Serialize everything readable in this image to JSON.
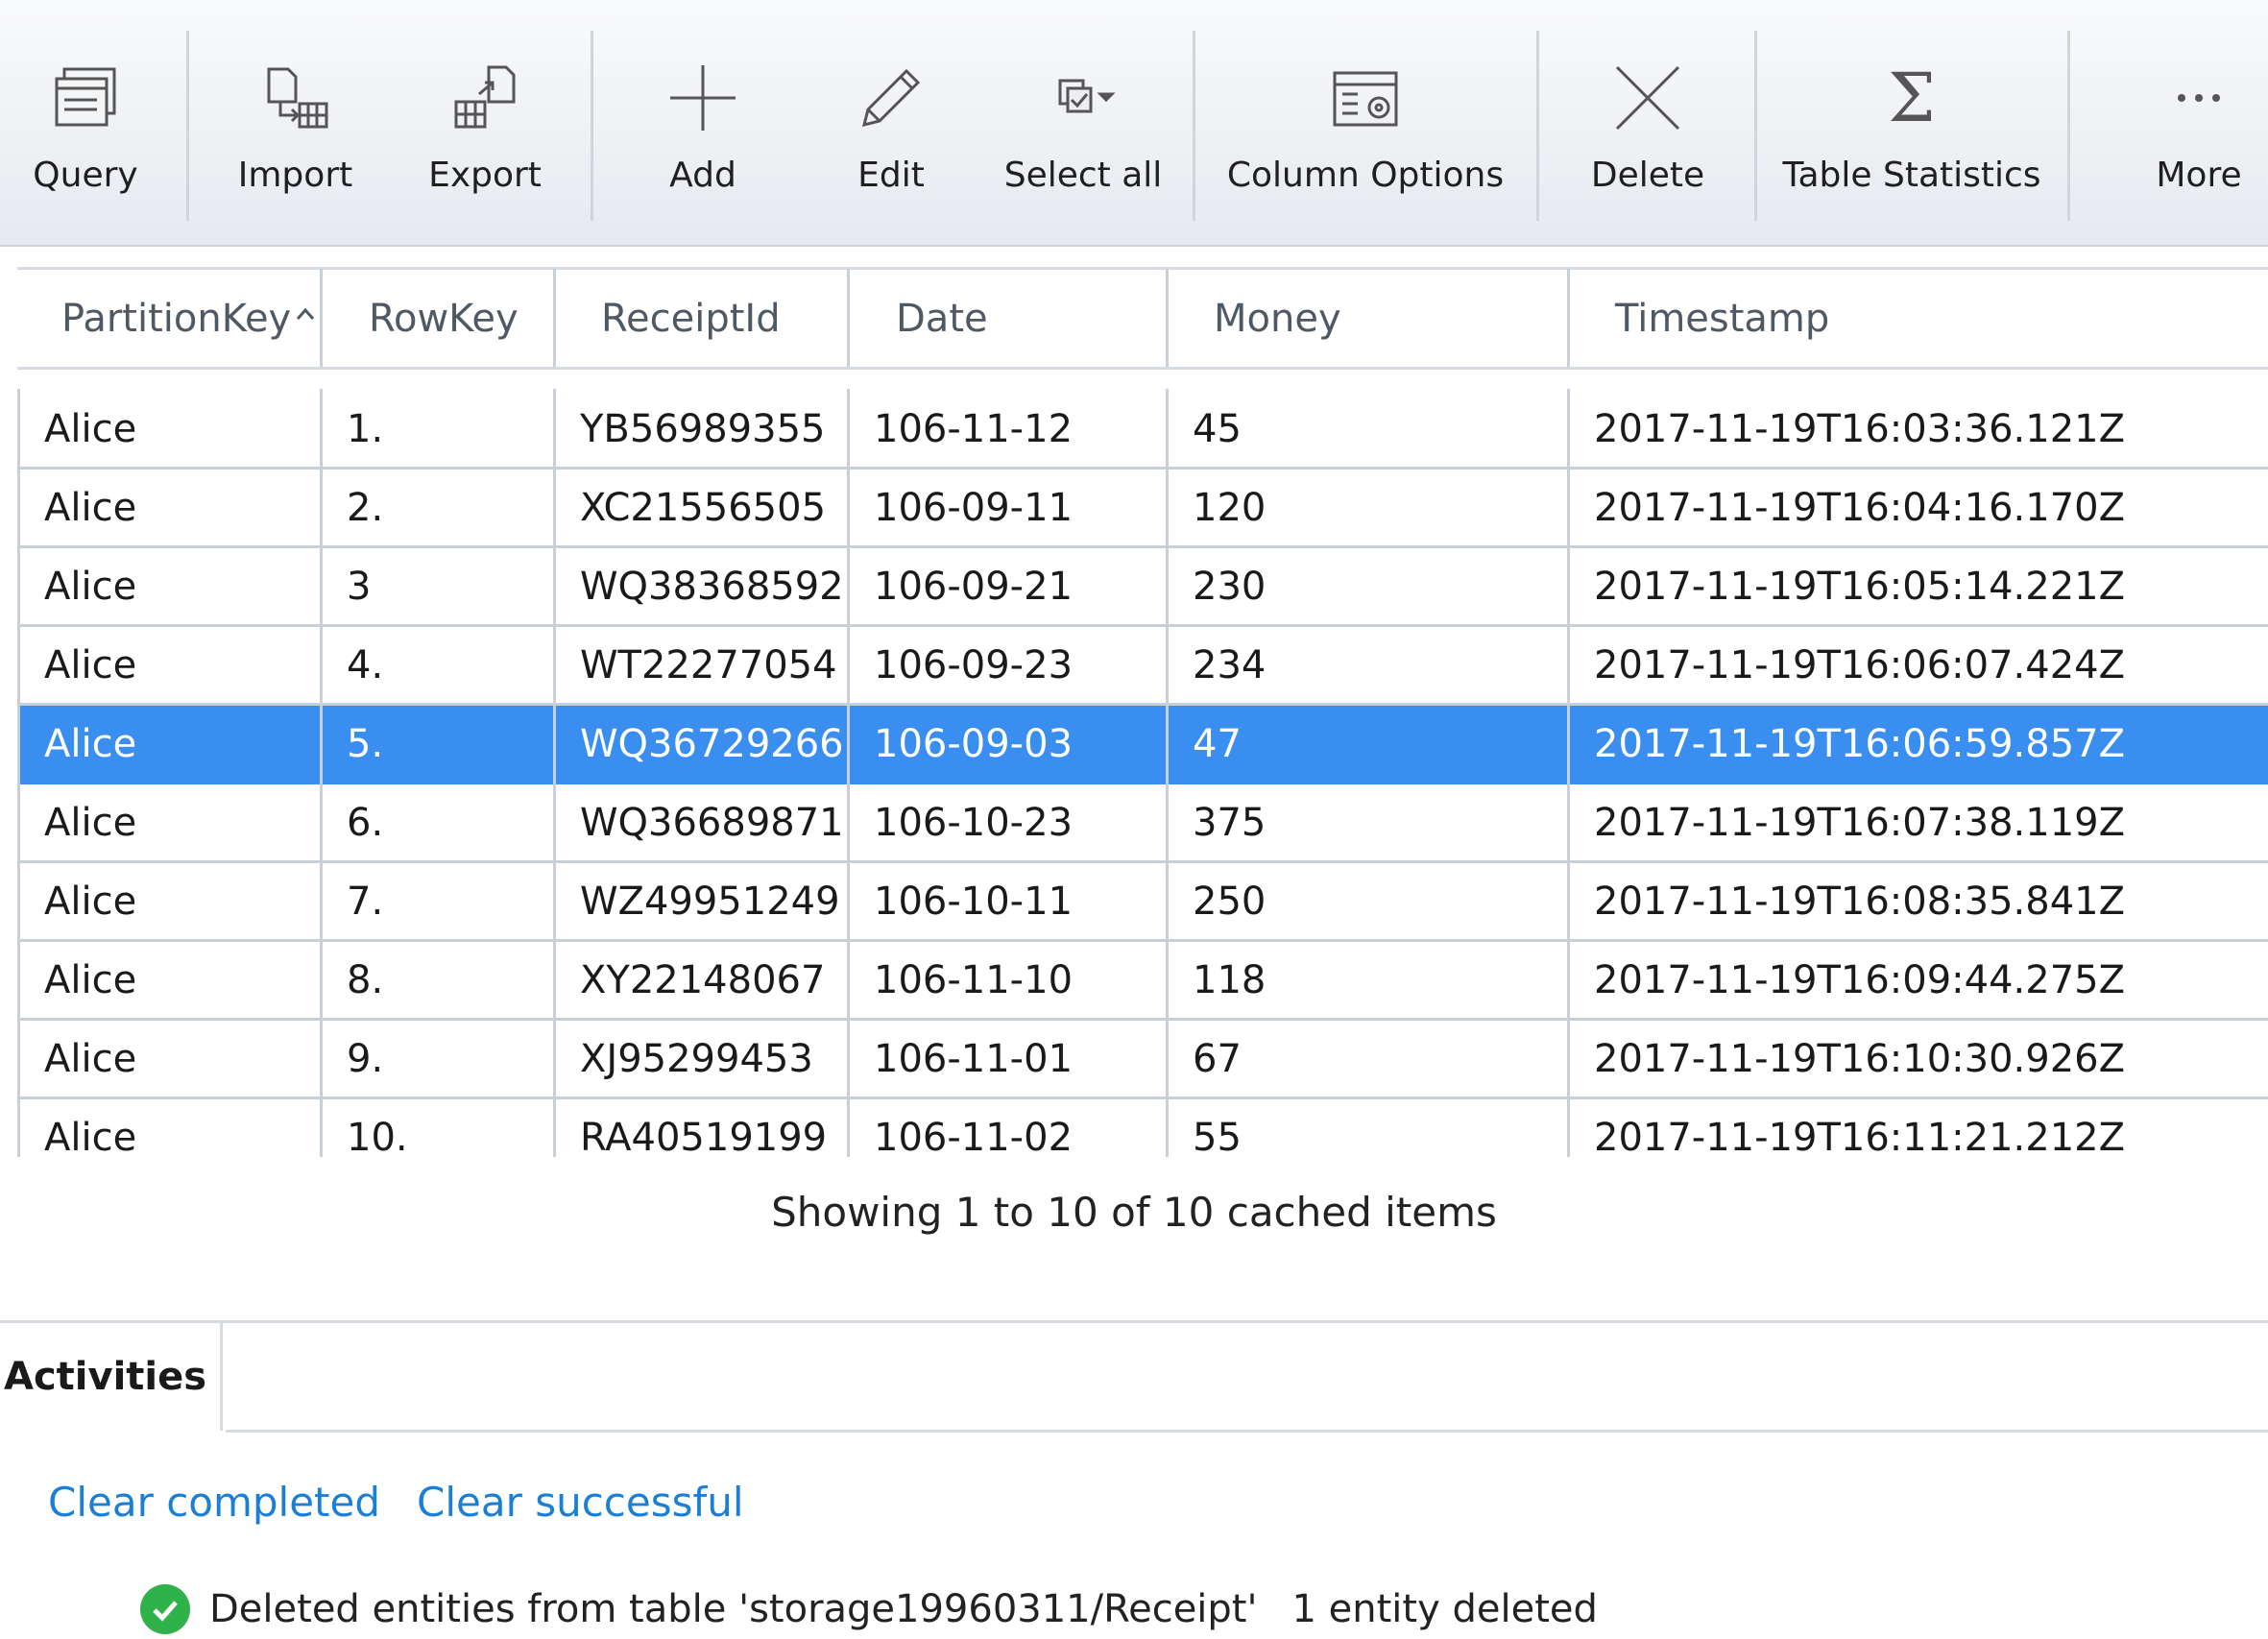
{
  "toolbar": {
    "query": "Query",
    "import": "Import",
    "export": "Export",
    "add": "Add",
    "edit": "Edit",
    "select_all": "Select all",
    "column_options": "Column Options",
    "delete": "Delete",
    "table_statistics": "Table Statistics",
    "more": "More"
  },
  "table": {
    "columns": [
      "PartitionKey",
      "RowKey",
      "ReceiptId",
      "Date",
      "Money",
      "Timestamp"
    ],
    "sort_column": "PartitionKey",
    "sort_direction": "ascending",
    "selected_row": 4,
    "rows": [
      [
        "Alice",
        "1.",
        "YB56989355",
        "106-11-12",
        "45",
        "2017-11-19T16:03:36.121Z"
      ],
      [
        "Alice",
        "2.",
        "XC21556505",
        "106-09-11",
        "120",
        "2017-11-19T16:04:16.170Z"
      ],
      [
        "Alice",
        "3",
        "WQ38368592",
        "106-09-21",
        "230",
        "2017-11-19T16:05:14.221Z"
      ],
      [
        "Alice",
        "4.",
        "WT22277054",
        "106-09-23",
        "234",
        "2017-11-19T16:06:07.424Z"
      ],
      [
        "Alice",
        "5.",
        "WQ36729266",
        "106-09-03",
        "47",
        "2017-11-19T16:06:59.857Z"
      ],
      [
        "Alice",
        "6.",
        "WQ36689871",
        "106-10-23",
        "375",
        "2017-11-19T16:07:38.119Z"
      ],
      [
        "Alice",
        "7.",
        "WZ49951249",
        "106-10-11",
        "250",
        "2017-11-19T16:08:35.841Z"
      ],
      [
        "Alice",
        "8.",
        "XY22148067",
        "106-11-10",
        "118",
        "2017-11-19T16:09:44.275Z"
      ],
      [
        "Alice",
        "9.",
        "XJ95299453",
        "106-11-01",
        "67",
        "2017-11-19T16:10:30.926Z"
      ],
      [
        "Alice",
        "10.",
        "RA40519199",
        "106-11-02",
        "55",
        "2017-11-19T16:11:21.212Z"
      ]
    ],
    "footer": "Showing 1 to 10 of 10 cached items"
  },
  "activities": {
    "tab_label": "Activities",
    "clear_completed": "Clear completed",
    "clear_successful": "Clear successful",
    "entries": [
      {
        "message": "Deleted entities from table 'storage19960311/Receipt'",
        "detail": "1 entity deleted",
        "status": "success"
      }
    ]
  },
  "colors": {
    "selection": "#3a8ef0",
    "link": "#1b7fd6",
    "success": "#2fb24a"
  }
}
